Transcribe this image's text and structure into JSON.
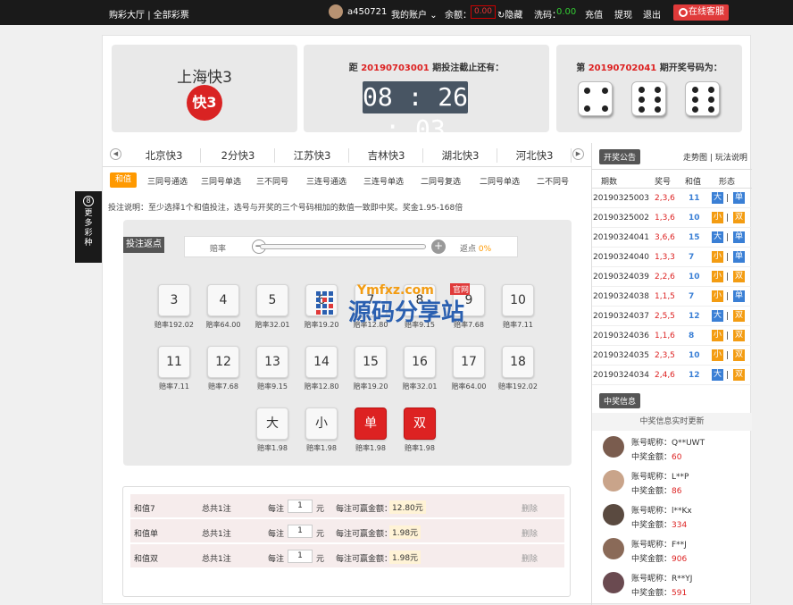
{
  "topbar": {
    "home": "购彩大厅",
    "sep": "|",
    "all": "全部彩票",
    "username": "a450721",
    "account": "我的账户",
    "balance_label": "余额：",
    "balance": "0.00",
    "hide": "隐藏",
    "wash_label": "洗码：",
    "wash": "0.00",
    "recharge": "充值",
    "withdraw": "提现",
    "logout": "退出",
    "service": "在线客服"
  },
  "game": {
    "title": "上海快3",
    "logo": "快3"
  },
  "countdown": {
    "prefix": "距",
    "period": "20190703001",
    "suffix": "期投注截止还有：",
    "time": "08 : 26 : 03"
  },
  "draw": {
    "prefix": "第",
    "period": "20190702041",
    "suffix": "期开奖号码为：",
    "dice": [
      4,
      6,
      6
    ]
  },
  "tabs": [
    "北京快3",
    "2分快3",
    "江苏快3",
    "吉林快3",
    "湖北快3",
    "河北快3"
  ],
  "subtabs": [
    "和值",
    "三同号通选",
    "三同号单选",
    "三不同号",
    "三连号通选",
    "三连号单选",
    "二同号复选",
    "二同号单选",
    "二不同号"
  ],
  "note": "投注说明：至少选择1个和值投注，选号与开奖的三个号码相加的数值一致即中奖。奖金1.95-168倍",
  "rebate": {
    "label": "投注返点",
    "odds_label": "赔率",
    "rebate_label": "返点",
    "rebate_value": "0%"
  },
  "balls_row1": [
    {
      "n": "3",
      "o": "赔率192.02"
    },
    {
      "n": "4",
      "o": "赔率64.00"
    },
    {
      "n": "5",
      "o": "赔率32.01"
    },
    {
      "n": "6",
      "o": "赔率19.20"
    },
    {
      "n": "7",
      "o": "赔率12.80"
    },
    {
      "n": "8",
      "o": "赔率9.15"
    },
    {
      "n": "9",
      "o": "赔率7.68"
    },
    {
      "n": "10",
      "o": "赔率7.11"
    }
  ],
  "balls_row2": [
    {
      "n": "11",
      "o": "赔率7.11"
    },
    {
      "n": "12",
      "o": "赔率7.68"
    },
    {
      "n": "13",
      "o": "赔率9.15"
    },
    {
      "n": "14",
      "o": "赔率12.80"
    },
    {
      "n": "15",
      "o": "赔率19.20"
    },
    {
      "n": "16",
      "o": "赔率32.01"
    },
    {
      "n": "17",
      "o": "赔率64.00"
    },
    {
      "n": "18",
      "o": "赔率192.02"
    }
  ],
  "balls_row3": [
    {
      "n": "大",
      "o": "赔率1.98"
    },
    {
      "n": "小",
      "o": "赔率1.98"
    },
    {
      "n": "单",
      "o": "赔率1.98"
    },
    {
      "n": "双",
      "o": "赔率1.98"
    }
  ],
  "watermark": {
    "domain": "Ymfxz.com",
    "tag": "官网",
    "name": "源码分享站"
  },
  "orders": [
    {
      "name": "和值7",
      "total": "总共1注",
      "per": "每注",
      "qty": "1",
      "unit": "元",
      "win_label": "每注可赢金额：",
      "win": "12.80元",
      "del": "删除"
    },
    {
      "name": "和值单",
      "total": "总共1注",
      "per": "每注",
      "qty": "1",
      "unit": "元",
      "win_label": "每注可赢金额：",
      "win": "1.98元",
      "del": "删除"
    },
    {
      "name": "和值双",
      "total": "总共1注",
      "per": "每注",
      "qty": "1",
      "unit": "元",
      "win_label": "每注可赢金额：",
      "win": "1.98元",
      "del": "删除"
    }
  ],
  "side": {
    "notice": "开奖公告",
    "trend": "走势图",
    "sep": "|",
    "rules": "玩法说明",
    "headers": [
      "期数",
      "奖号",
      "和值",
      "形态"
    ],
    "rows": [
      [
        "20190325003",
        "2,3,6",
        "11",
        "大",
        "单"
      ],
      [
        "20190325002",
        "1,3,6",
        "10",
        "小",
        "双"
      ],
      [
        "20190324041",
        "3,6,6",
        "15",
        "大",
        "单"
      ],
      [
        "20190324040",
        "1,3,3",
        "7",
        "小",
        "单"
      ],
      [
        "20190324039",
        "2,2,6",
        "10",
        "小",
        "双"
      ],
      [
        "20190324038",
        "1,1,5",
        "7",
        "小",
        "单"
      ],
      [
        "20190324037",
        "2,5,5",
        "12",
        "大",
        "双"
      ],
      [
        "20190324036",
        "1,1,6",
        "8",
        "小",
        "双"
      ],
      [
        "20190324035",
        "2,3,5",
        "10",
        "小",
        "双"
      ],
      [
        "20190324034",
        "2,4,6",
        "12",
        "大",
        "双"
      ]
    ],
    "winners_title": "中奖信息",
    "realtime": "中奖信息实时更新",
    "winners": [
      {
        "nick": "账号昵称：Q**UWT",
        "amt_label": "中奖金额：",
        "amt": "60"
      },
      {
        "nick": "账号昵称：L**P",
        "amt_label": "中奖金额：",
        "amt": "86"
      },
      {
        "nick": "账号昵称：l**Kx",
        "amt_label": "中奖金额：",
        "amt": "334"
      },
      {
        "nick": "账号昵称：F**J",
        "amt_label": "中奖金额：",
        "amt": "906"
      },
      {
        "nick": "账号昵称：R**YJ",
        "amt_label": "中奖金额：",
        "amt": "591"
      }
    ]
  },
  "more": "更多彩种"
}
